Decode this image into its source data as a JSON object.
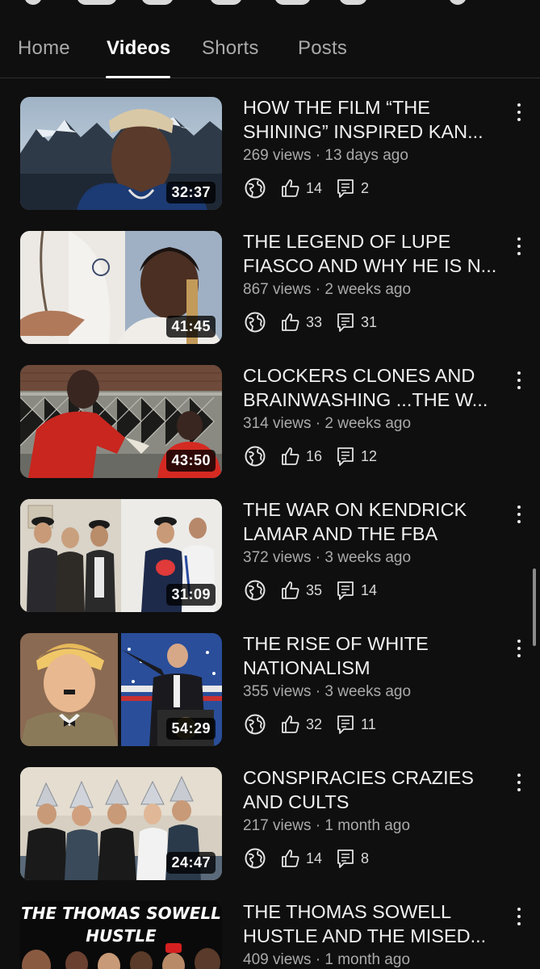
{
  "tabs": [
    {
      "label": "Home",
      "active": false
    },
    {
      "label": "Videos",
      "active": true
    },
    {
      "label": "Shorts",
      "active": false
    },
    {
      "label": "Posts",
      "active": false
    }
  ],
  "videos": [
    {
      "title_line1": "HOW THE FILM  “THE",
      "title_line2": "SHINING”  INSPIRED KAN...",
      "meta": "269 views · 13 days ago",
      "duration": "32:37",
      "likes": "14",
      "comments": "2"
    },
    {
      "title_line1": "THE LEGEND OF LUPE",
      "title_line2": "FIASCO AND WHY HE IS N...",
      "meta": "867 views · 2 weeks ago",
      "duration": "41:45",
      "likes": "33",
      "comments": "31"
    },
    {
      "title_line1": "CLOCKERS CLONES AND",
      "title_line2": "BRAINWASHING ...THE W...",
      "meta": "314 views · 2 weeks ago",
      "duration": "43:50",
      "likes": "16",
      "comments": "12"
    },
    {
      "title_line1": "THE WAR ON KENDRICK",
      "title_line2": "LAMAR AND THE FBA",
      "meta": "372 views · 3 weeks ago",
      "duration": "31:09",
      "likes": "35",
      "comments": "14"
    },
    {
      "title_line1": "THE RISE OF WHITE",
      "title_line2": "NATIONALISM",
      "meta": "355 views · 3 weeks ago",
      "duration": "54:29",
      "likes": "32",
      "comments": "11"
    },
    {
      "title_line1": "CONSPIRACIES CRAZIES",
      "title_line2": "AND CULTS",
      "meta": "217 views · 1 month ago",
      "duration": "24:47",
      "likes": "14",
      "comments": "8"
    },
    {
      "title_line1": "THE THOMAS SOWELL",
      "title_line2": "HUSTLE AND THE MISED...",
      "meta": "409 views · 1 month ago",
      "thumb_text_line1": "THE THOMAS SOWELL",
      "thumb_text_line2": "HUSTLE"
    }
  ],
  "icons": {
    "visibility": "globe-icon",
    "like": "thumbs-up-icon",
    "comment": "comment-icon",
    "menu": "kebab-menu-icon"
  },
  "colors": {
    "background": "#0f0f0f",
    "text_primary": "#f1f1f1",
    "text_secondary": "#aaaaaa"
  }
}
